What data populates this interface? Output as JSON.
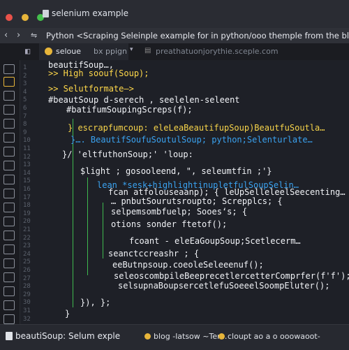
{
  "window": {
    "title": "selenium example"
  },
  "pathbar": {
    "back": "‹",
    "forward": "›",
    "path": "Python <Scraping Seleinple example for in python/ooo themple from the blog"
  },
  "tabs": [
    {
      "label": "seloue",
      "active": true
    },
    {
      "label": "bx ppign"
    },
    {
      "label": "preathatuonjorythie.sceple.com"
    }
  ],
  "colors": {
    "accent": "#e7b53a",
    "guide": "#3fb94f",
    "close": "#e9524a",
    "minimize": "#e7b53a",
    "maximize": "#44c04c"
  },
  "editor": {
    "line_numbers": [
      "1",
      "2",
      "3",
      "4",
      "5",
      "6",
      "7",
      "8",
      "9",
      "10",
      "11",
      "12",
      "13",
      "14",
      "15",
      "16",
      "17",
      "18",
      "19",
      "20",
      "21",
      "22",
      "23",
      "24",
      "25",
      "26",
      "27",
      "28",
      "29",
      "30",
      "31",
      "32"
    ],
    "lines": [
      {
        "text": "beautifSoup…,",
        "color": "#f1f3f7"
      },
      {
        "text": ">> High soouf(Soup);",
        "color": "#ffd84a"
      },
      {
        "text": ">> Selutformate—>",
        "color": "#ffd84a"
      },
      {
        "text": "#beautSoup d-serech , seelelen-seleent",
        "color": "#f1f3f7"
      },
      {
        "text": "#batifumSoupingScreps(f);",
        "color": "#f1f3f7"
      },
      {
        "text": "} escrapfumcoup: eleLeaBeautifupSoup)BeautfuSoutla…",
        "color": "#f7d44a"
      },
      {
        "text": "}…. BeautifSoufuSoutulSoup; python;Selenturlate…",
        "color": "#3aa2f0"
      },
      {
        "text": "}/ 'eltfuthonSoup;' 'loup:",
        "color": "#f1f3f7"
      },
      {
        "text": "$light ; gosooleend, \", seleumtfin ;'}",
        "color": "#f1f3f7"
      },
      {
        "text": "lean *sesk+highlightinupletfulSoupSelin…",
        "color": "#3aa2f0"
      },
      {
        "text": "fcan atfolouseaanp); {  leUpSelleleelSeecenting…",
        "color": "#f1f3f7"
      },
      {
        "text": "… pnbutSourutsroupto; Screpplcs; {",
        "color": "#f1f3f7"
      },
      {
        "text": "selpemsombfuelp; Sooes‘s; {",
        "color": "#f1f3f7"
      },
      {
        "text": "otions sonder ftetof();",
        "color": "#f1f3f7"
      },
      {
        "text": "fcoant - eleEaGoupSoup;Scetlecerm…",
        "color": "#f1f3f7"
      },
      {
        "text": "seanctccreashr ; {",
        "color": "#f1f3f7"
      },
      {
        "text": "eeButnpsoup.coeoleSeleeenuf();",
        "color": "#f1f3f7"
      },
      {
        "text": "seleoscombpileBeeprecetlercetterComprfer(f'f');",
        "color": "#f1f3f7"
      },
      {
        "text": "selsupnaBoupsercetlefuSoeeelSoompEluter();",
        "color": "#f1f3f7"
      },
      {
        "text": "}),  };",
        "color": "#f1f3f7"
      },
      {
        "text": "}",
        "color": "#f1f3f7"
      }
    ]
  },
  "statusbar": {
    "left": "beautiSoup:  Selum exple",
    "center": "blog -latsow ~Tem.",
    "right": "cloupt ao a o ooowaoot-"
  }
}
